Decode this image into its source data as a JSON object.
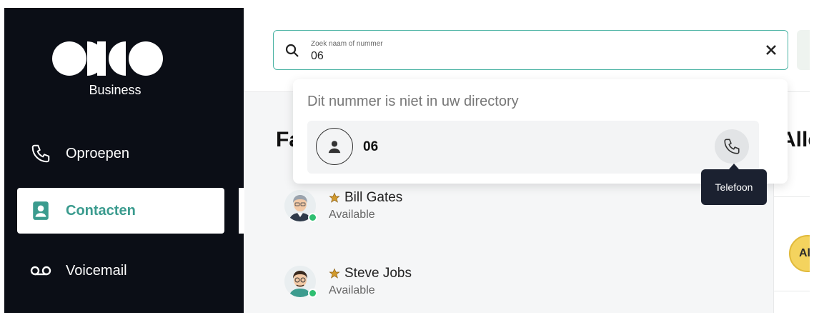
{
  "brand": {
    "sub": "Business"
  },
  "sidebar": {
    "items": [
      {
        "label": "Oproepen",
        "icon": "phone-icon"
      },
      {
        "label": "Contacten",
        "icon": "contacts-icon",
        "active": true
      },
      {
        "label": "Voicemail",
        "icon": "voicemail-icon"
      }
    ]
  },
  "search": {
    "label": "Zoek naam of nummer",
    "value": "06"
  },
  "dropdown": {
    "hint": "Dit nummer is niet in uw directory",
    "result_number": "06",
    "call_tooltip": "Telefoon"
  },
  "sections": {
    "left_title_partial": "Fa",
    "right_title_partial": "Alle"
  },
  "contacts": [
    {
      "name": "Bill Gates",
      "status": "Available",
      "favorite": true
    },
    {
      "name": "Steve Jobs",
      "status": "Available",
      "favorite": true
    }
  ],
  "right_avatar_initials": "Al",
  "colors": {
    "sidebar_bg": "#0b0e16",
    "accent": "#3a9b8e",
    "search_border": "#4bb3a4",
    "online": "#2fbf71",
    "star": "#d29a2c",
    "tooltip_bg": "#1b2130"
  }
}
